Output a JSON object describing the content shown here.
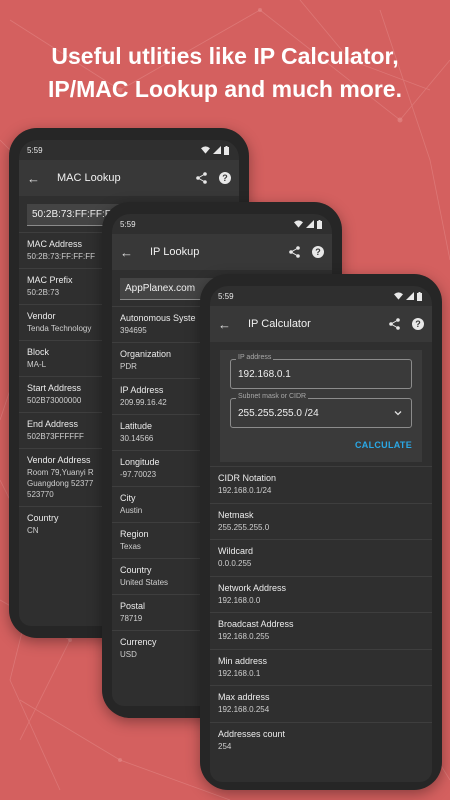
{
  "headline": {
    "line1": "Useful utlities like IP Calculator,",
    "line2": "IP/MAC Lookup and much more."
  },
  "colors": {
    "background": "#d4605f",
    "accent": "#2aa8e6",
    "screen": "#2f2f2f",
    "appbar": "#383838"
  },
  "icons": [
    "back-arrow-icon",
    "share-icon",
    "help-icon",
    "wifi-icon",
    "signal-icon",
    "battery-icon",
    "chevron-down-icon"
  ],
  "mac_lookup": {
    "time": "5:59",
    "title": "MAC Lookup",
    "query": "50:2B:73:FF:FF:FF",
    "rows": [
      {
        "label": "MAC Address",
        "value": "50:2B:73:FF:FF:FF"
      },
      {
        "label": "MAC Prefix",
        "value": "50:2B:73"
      },
      {
        "label": "Vendor",
        "value": "Tenda Technology"
      },
      {
        "label": "Block",
        "value": "MA-L"
      },
      {
        "label": "Start Address",
        "value": "502B73000000"
      },
      {
        "label": "End Address",
        "value": "502B73FFFFFF"
      },
      {
        "label": "Vendor Address",
        "value": "Room 79,Yuanyi R\nGuangdong 52377\n523770"
      },
      {
        "label": "Country",
        "value": "CN"
      }
    ]
  },
  "ip_lookup": {
    "time": "5:59",
    "title": "IP Lookup",
    "query": "AppPlanex.com",
    "rows": [
      {
        "label": "Autonomous Syste",
        "value": "394695"
      },
      {
        "label": "Organization",
        "value": "PDR"
      },
      {
        "label": "IP Address",
        "value": "209.99.16.42"
      },
      {
        "label": "Latitude",
        "value": "30.14566"
      },
      {
        "label": "Longitude",
        "value": "-97.70023"
      },
      {
        "label": "City",
        "value": "Austin"
      },
      {
        "label": "Region",
        "value": "Texas"
      },
      {
        "label": "Country",
        "value": "United States"
      },
      {
        "label": "Postal",
        "value": "78719"
      },
      {
        "label": "Currency",
        "value": "USD"
      }
    ]
  },
  "ip_calculator": {
    "time": "5:59",
    "title": "IP Calculator",
    "ip_label": "IP address",
    "ip_value": "192.168.0.1",
    "mask_label": "Subnet mask or CIDR",
    "mask_value": "255.255.255.0 /24",
    "calculate": "CALCULATE",
    "rows": [
      {
        "label": "CIDR Notation",
        "value": "192.168.0.1/24"
      },
      {
        "label": "Netmask",
        "value": "255.255.255.0"
      },
      {
        "label": "Wildcard",
        "value": "0.0.0.255"
      },
      {
        "label": "Network Address",
        "value": "192.168.0.0"
      },
      {
        "label": "Broadcast Address",
        "value": "192.168.0.255"
      },
      {
        "label": "Min address",
        "value": "192.168.0.1"
      },
      {
        "label": "Max address",
        "value": "192.168.0.254"
      },
      {
        "label": "Addresses count",
        "value": "254"
      }
    ]
  }
}
